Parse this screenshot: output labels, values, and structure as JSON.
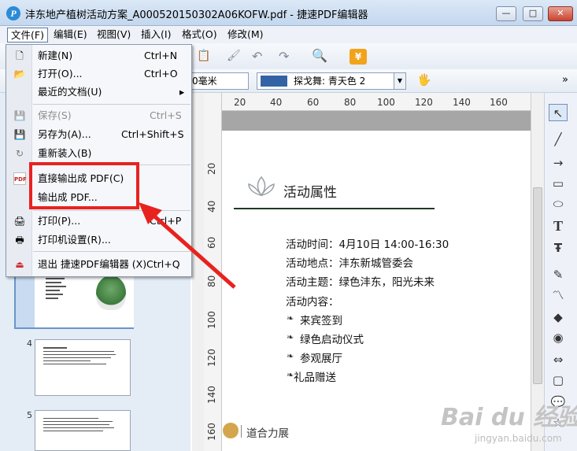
{
  "window": {
    "title": "沣东地产植树活动方案_A000520150302A06KOFW.pdf - 捷速PDF编辑器",
    "app_icon_letter": "P",
    "buttons": [
      "—",
      "□",
      "✕"
    ]
  },
  "menubar": {
    "items": [
      "文件(F)",
      "编辑(E)",
      "视图(V)",
      "插入(I)",
      "格式(O)",
      "修改(M)"
    ]
  },
  "toolbar": {
    "unit_combo": "0毫米",
    "color_combo_label": "探戈舞: 青天色 2",
    "color_swatch": "#3363a4",
    "overflow": "»"
  },
  "file_menu": {
    "items": [
      {
        "icon": "new-doc-icon",
        "label": "新建(N)",
        "shortcut": "Ctrl+N",
        "disabled": false
      },
      {
        "icon": "open-folder-icon",
        "label": "打开(O)...",
        "shortcut": "Ctrl+O",
        "disabled": false
      },
      {
        "icon": "",
        "label": "最近的文档(U)",
        "shortcut": "▸",
        "disabled": false
      },
      {
        "icon": "save-icon",
        "label": "保存(S)",
        "shortcut": "Ctrl+S",
        "disabled": true
      },
      {
        "icon": "save-as-icon",
        "label": "另存为(A)...",
        "shortcut": "Ctrl+Shift+S",
        "disabled": false
      },
      {
        "icon": "reload-icon",
        "label": "重新装入(B)",
        "shortcut": "",
        "disabled": false
      },
      {
        "icon": "pdf-icon",
        "label": "直接输出成 PDF(C)",
        "shortcut": "",
        "disabled": false
      },
      {
        "icon": "",
        "label": "输出成 PDF...",
        "shortcut": "",
        "disabled": false
      },
      {
        "icon": "print-icon",
        "label": "打印(P)...",
        "shortcut": "Ctrl+P",
        "disabled": false
      },
      {
        "icon": "printer-settings-icon",
        "label": "打印机设置(R)...",
        "shortcut": "",
        "disabled": false
      },
      {
        "icon": "exit-icon",
        "label": "退出 捷速PDF编辑器 (X)",
        "shortcut": "Ctrl+Q",
        "disabled": false
      }
    ]
  },
  "rulers": {
    "horizontal": [
      "20",
      "40",
      "60",
      "80",
      "100",
      "120",
      "140",
      "160"
    ],
    "vertical": [
      "20",
      "40",
      "60",
      "80",
      "100",
      "120",
      "140",
      "160"
    ]
  },
  "thumbnails": {
    "pages": [
      "4",
      "5"
    ]
  },
  "document": {
    "section_title": "活动属性",
    "lines": [
      "活动时间：4月10日 14:00-16:30",
      "活动地点：沣东新城管委会",
      "活动主题：绿色沣东，阳光未来",
      "活动内容："
    ],
    "bullets": [
      "来宾签到",
      "绿色启动仪式",
      "参观展厅",
      "礼品赠送"
    ],
    "footer_brand": "道合力展"
  },
  "watermark": {
    "text": "Bai du 经验",
    "url": "jingyan.baidu.com"
  }
}
